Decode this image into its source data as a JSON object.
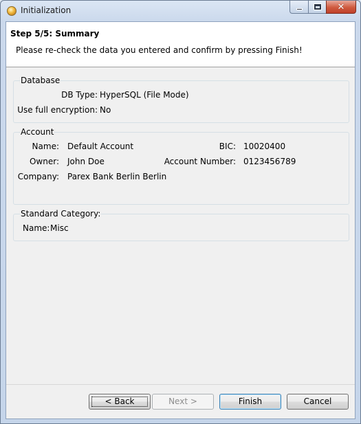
{
  "window": {
    "title": "Initialization"
  },
  "header": {
    "step_title": "Step 5/5: Summary",
    "description": "Please re-check the data you entered and confirm by pressing Finish!"
  },
  "database": {
    "label": "Database",
    "db_type_label": "DB Type:",
    "db_type_value": "HyperSQL (File Mode)",
    "encryption_label": "Use full encryption:",
    "encryption_value": "No"
  },
  "account": {
    "label": "Account",
    "name_label": "Name:",
    "name_value": "Default Account",
    "owner_label": "Owner:",
    "owner_value": "John Doe",
    "company_label": "Company:",
    "company_value": "Parex Bank Berlin Berlin",
    "bic_label": "BIC:",
    "bic_value": "10020400",
    "number_label": "Account Number:",
    "number_value": "0123456789"
  },
  "category": {
    "label": "Standard Category:",
    "name_label": "Name:",
    "name_value": "Misc"
  },
  "buttons": {
    "back_label": "< Back",
    "next_label": "Next >",
    "finish_label": "Finish",
    "cancel_label": "Cancel"
  }
}
